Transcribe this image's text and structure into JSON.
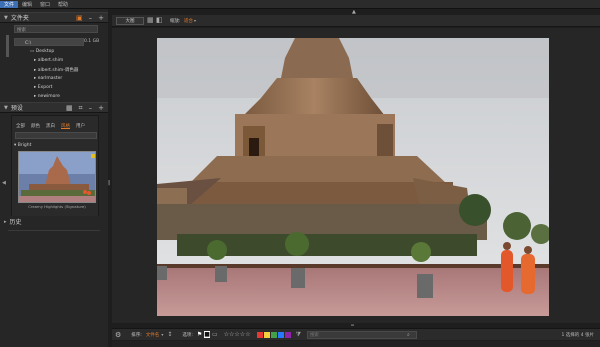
{
  "menu": [
    "文件",
    "编辑",
    "窗口",
    "帮助"
  ],
  "folders_panel": {
    "title": "文件夹",
    "search_value": "搜索",
    "path_value": "C:\\",
    "disk_value": "0.1 GB",
    "tree": [
      "Desktop",
      "albert.shim",
      "albert.shim-调色器",
      "earlmaster",
      "Export",
      "newimore"
    ]
  },
  "adjust_panel": {
    "title": "预设",
    "tabs": [
      "全部",
      "颜色",
      "黑白",
      "风格",
      "用户"
    ],
    "selected_tab": "风格",
    "group_label": "Bright",
    "preset_caption": "Creamy Highlights (Signature)"
  },
  "history_panel": {
    "title": "历史"
  },
  "toolbar": {
    "view_label": "大图",
    "thumb_label": "缩放:",
    "thumb_value": "适合"
  },
  "statusbar": {
    "sort_label": "排序:",
    "sort_value": "文件名",
    "select_label": "选项:",
    "color_labels": [
      "#e53935",
      "#f4d03f",
      "#43a047",
      "#2979ff",
      "#8e24aa"
    ],
    "search_placeholder": "搜索",
    "count_text": "1 选择的 4 张片"
  },
  "colors": {
    "accent": "#e07a2a",
    "selected_blue": "#3d6fb5"
  }
}
